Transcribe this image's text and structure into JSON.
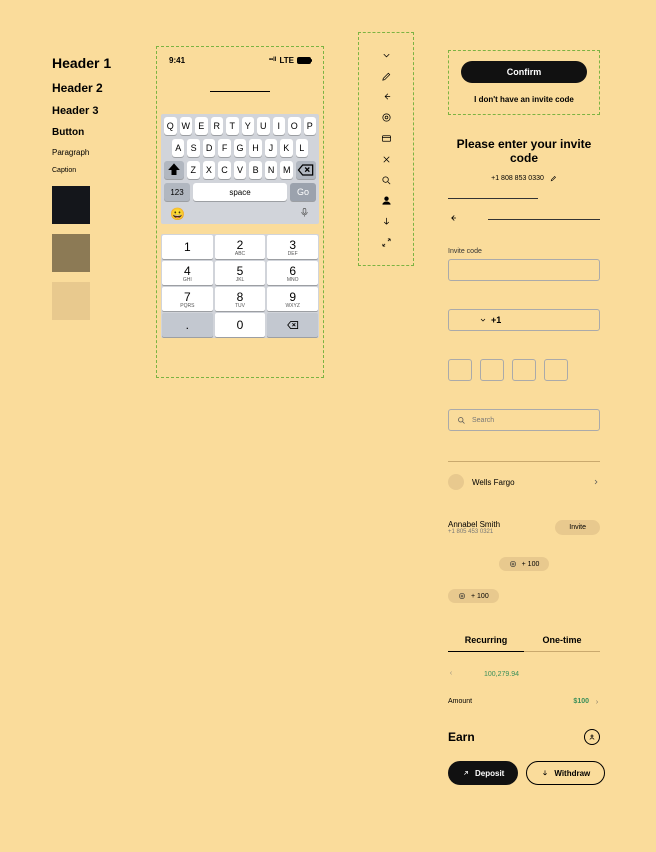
{
  "typography": {
    "h1": "Header 1",
    "h2": "Header 2",
    "h3": "Header 3",
    "button": "Button",
    "paragraph": "Paragraph",
    "caption": "Caption"
  },
  "swatches": {
    "dark": "#14161b",
    "olive": "#8c7a55",
    "sand": "#e8c98e"
  },
  "status": {
    "time": "9:41",
    "signal": "••ll",
    "net": "LTE"
  },
  "qwerty": {
    "row1": [
      "Q",
      "W",
      "E",
      "R",
      "T",
      "Y",
      "U",
      "I",
      "O",
      "P"
    ],
    "row2": [
      "A",
      "S",
      "D",
      "F",
      "G",
      "H",
      "J",
      "K",
      "L"
    ],
    "row3": [
      "Z",
      "X",
      "C",
      "V",
      "B",
      "N",
      "M"
    ],
    "k123": "123",
    "space": "space",
    "go": "Go"
  },
  "numpad": {
    "r1": [
      {
        "n": "1",
        "s": ""
      },
      {
        "n": "2",
        "s": "ABC"
      },
      {
        "n": "3",
        "s": "DEF"
      }
    ],
    "r2": [
      {
        "n": "4",
        "s": "GHI"
      },
      {
        "n": "5",
        "s": "JKL"
      },
      {
        "n": "6",
        "s": "MNO"
      }
    ],
    "r3": [
      {
        "n": "7",
        "s": "PQRS"
      },
      {
        "n": "8",
        "s": "TUV"
      },
      {
        "n": "9",
        "s": "WXYZ"
      }
    ],
    "r4": [
      {
        "n": ".",
        "s": ""
      },
      {
        "n": "0",
        "s": ""
      }
    ]
  },
  "cta": {
    "confirm": "Confirm",
    "no_invite": "I don't have an invite code"
  },
  "inviteTitle": "Please enter your invite code",
  "phone": "+1 808 853 0330",
  "inviteLabel": "Invite code",
  "prefix": "+1",
  "searchPlaceholder": "Search",
  "bank": {
    "name": "Wells Fargo"
  },
  "contact": {
    "name": "Annabel Smith",
    "phone": "+1 805 453 0321",
    "action": "Invite"
  },
  "chip": "+ 100",
  "tabs": {
    "recurring": "Recurring",
    "onetime": "One-time"
  },
  "amount": {
    "value": "100,279.94"
  },
  "amountLine": {
    "label": "Amount",
    "value": "$100"
  },
  "earn": {
    "title": "Earn",
    "deposit": "Deposit",
    "withdraw": "Withdraw"
  }
}
